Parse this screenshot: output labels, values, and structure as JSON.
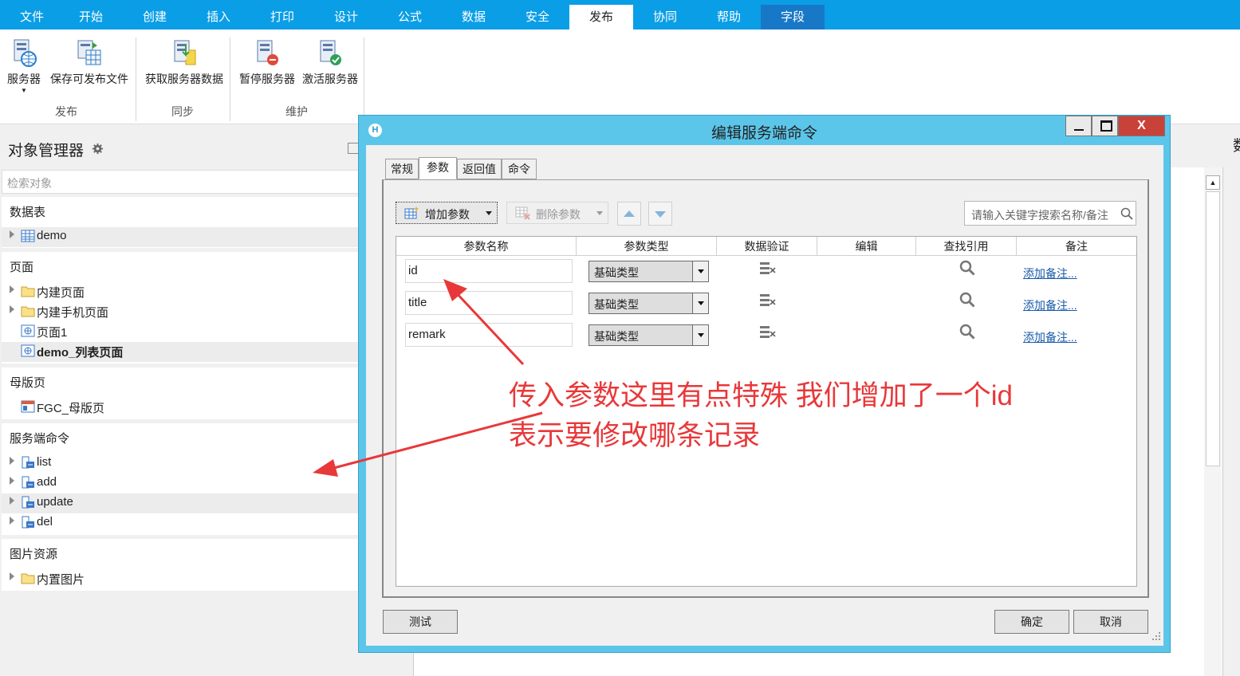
{
  "menu": {
    "tabs": [
      "文件",
      "开始",
      "创建",
      "插入",
      "打印",
      "设计",
      "公式",
      "数据",
      "安全",
      "发布",
      "协同",
      "帮助",
      "字段"
    ],
    "active_tab": "发布"
  },
  "ribbon": {
    "buttons": {
      "server": "服务器",
      "save_publish": "保存可发布文件",
      "get_server_data": "获取服务器数据",
      "pause_server": "暂停服务器",
      "activate_server": "激活服务器"
    },
    "groups": {
      "publish": "发布",
      "sync": "同步",
      "maintain": "维护"
    }
  },
  "left_panel": {
    "title": "对象管理器",
    "search_placeholder": "检索对象",
    "sections": {
      "tables": {
        "title": "数据表",
        "items": [
          "demo"
        ]
      },
      "pages": {
        "title": "页面",
        "items": [
          "内建页面",
          "内建手机页面",
          "页面1",
          "demo_列表页面"
        ]
      },
      "master": {
        "title": "母版页",
        "items": [
          "FGC_母版页"
        ]
      },
      "server_cmds": {
        "title": "服务端命令",
        "items": [
          "list",
          "add",
          "update",
          "del"
        ]
      },
      "images": {
        "title": "图片资源",
        "items": [
          "内置图片"
        ]
      }
    }
  },
  "right_edge_text": "数",
  "dialog": {
    "title": "编辑服务端命令",
    "logo": "H",
    "close": "X",
    "tabs": [
      "常规",
      "参数",
      "返回值",
      "命令"
    ],
    "active_tab": "参数",
    "toolbar": {
      "add_param": "增加参数",
      "delete_param": "删除参数",
      "search_placeholder": "请输入关键字搜索名称/备注"
    },
    "columns": [
      "参数名称",
      "参数类型",
      "数据验证",
      "编辑",
      "查找引用",
      "备注"
    ],
    "rows": [
      {
        "name": "id",
        "type": "基础类型",
        "note": "添加备注..."
      },
      {
        "name": "title",
        "type": "基础类型",
        "note": "添加备注..."
      },
      {
        "name": "remark",
        "type": "基础类型",
        "note": "添加备注..."
      }
    ],
    "buttons": {
      "test": "测试",
      "ok": "确定",
      "cancel": "取消"
    }
  },
  "annotation": {
    "line1": "传入参数这里有点特殊 我们增加了一个id",
    "line2": "表示要修改哪条记录",
    "color": "#e8383a"
  },
  "colors": {
    "menubar": "#0a9ee6",
    "dialog_frame": "#5bc6ea",
    "close_button": "#c8423a",
    "link": "#1a5aa8"
  }
}
